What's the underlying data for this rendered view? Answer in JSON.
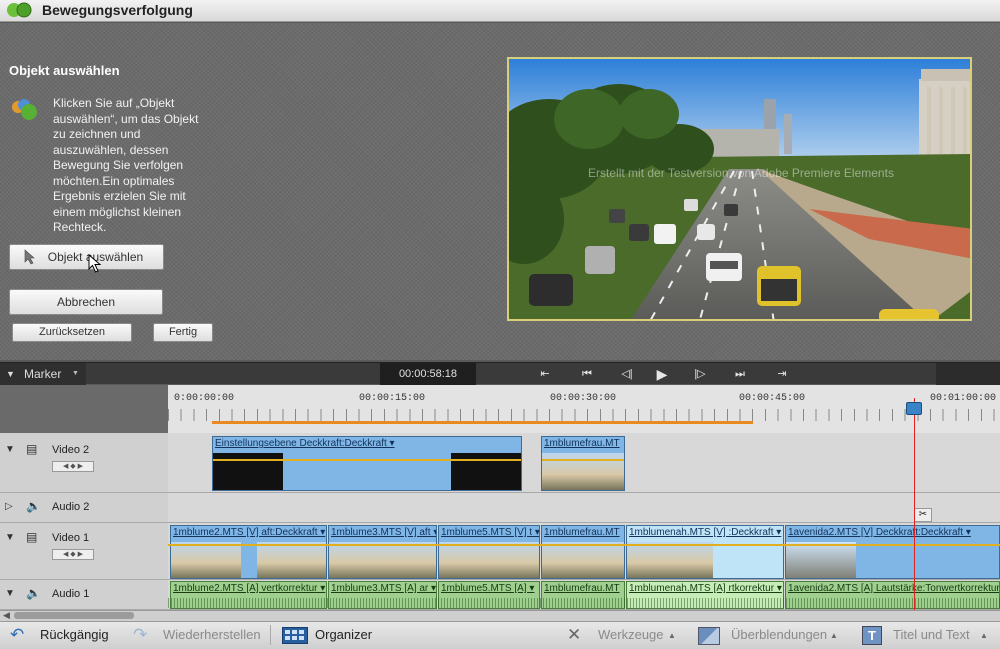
{
  "window": {
    "title": "Bewegungsverfolgung"
  },
  "panel": {
    "section_title": "Objekt auswählen",
    "instructions": "Klicken Sie auf „Objekt auswählen“, um das Objekt zu zeichnen und auszuwählen, dessen Bewegung Sie verfolgen möchten.Ein optimales Ergebnis erzielen Sie mit einem möglichst kleinen Rechteck.",
    "select_object_button": "Objekt auswählen",
    "cancel_button": "Abbrechen",
    "reset_button": "Zurücksetzen",
    "done_button": "Fertig"
  },
  "preview": {
    "watermark": "Erstellt mit der Testversion von Adobe Premiere Elements"
  },
  "timeline_toolbar": {
    "marker_label": "Marker",
    "timecode": "00:00:58:18"
  },
  "ruler": {
    "ticks": [
      "0:00:00:00",
      "00:00:15:00",
      "00:00:30:00",
      "00:00:45:00",
      "00:01:00:00"
    ]
  },
  "tracks": [
    {
      "name": "Video 2",
      "type": "video"
    },
    {
      "name": "Audio 2",
      "type": "audio"
    },
    {
      "name": "Video 1",
      "type": "video"
    },
    {
      "name": "Audio 1",
      "type": "audio"
    }
  ],
  "clips": {
    "video2": [
      {
        "label": "Einstellungsebene Deckkraft:Deckkraft ▾"
      },
      {
        "label": "1mblumefrau.MT"
      }
    ],
    "video1": [
      {
        "label": "1mblume2.MTS [V] aft:Deckkraft ▾"
      },
      {
        "label": "1mblume3.MTS [V] aft ▾"
      },
      {
        "label": "1mblume5.MTS [V] t ▾"
      },
      {
        "label": "1mblumefrau.MT"
      },
      {
        "label": "1mblumenah.MTS [V] :Deckkraft ▾"
      },
      {
        "label": "1avenida2.MTS [V] Deckkraft:Deckkraft ▾"
      }
    ],
    "audio1": [
      {
        "label": "1mblume2.MTS [A] vertkorrektur ▾"
      },
      {
        "label": "1mblume3.MTS [A] ar ▾"
      },
      {
        "label": "1mblume5.MTS [A] ▾"
      },
      {
        "label": "1mblumefrau.MT"
      },
      {
        "label": "1mblumenah.MTS [A] rtkorrektur ▾"
      },
      {
        "label": "1avenida2.MTS [A] Lautstärke:Tonwertkorrektur"
      }
    ]
  },
  "bottom_bar": {
    "undo": "Rückgängig",
    "redo": "Wiederherstellen",
    "organizer": "Organizer",
    "tools": "Werkzeuge",
    "transitions": "Überblendungen",
    "titles": "Titel und Text"
  },
  "colors": {
    "video_clip": "#7fb6e6",
    "audio_clip": "#9fd08f",
    "playhead": "#d22222",
    "preview_border": "#d8cf78"
  }
}
